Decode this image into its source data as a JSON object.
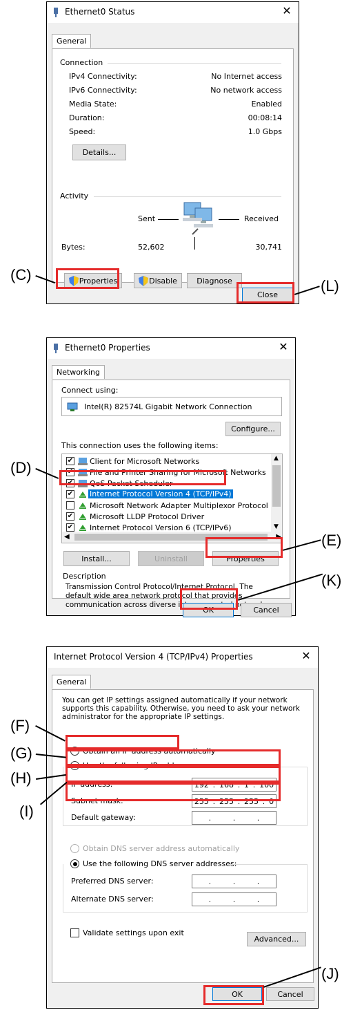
{
  "callouts": {
    "c": "(C)",
    "d": "(D)",
    "e": "(E)",
    "f": "(F)",
    "g": "(G)",
    "h": "(H)",
    "i": "(I)",
    "j": "(J)",
    "k": "(K)",
    "l": "(L)"
  },
  "status_dialog": {
    "title": "Ethernet0 Status",
    "tab": "General",
    "connection_header": "Connection",
    "rows": [
      {
        "label": "IPv4 Connectivity:",
        "value": "No Internet access"
      },
      {
        "label": "IPv6 Connectivity:",
        "value": "No network access"
      },
      {
        "label": "Media State:",
        "value": "Enabled"
      },
      {
        "label": "Duration:",
        "value": "00:08:14"
      },
      {
        "label": "Speed:",
        "value": "1.0 Gbps"
      }
    ],
    "details_button": "Details...",
    "activity_header": "Activity",
    "sent_label": "Sent",
    "received_label": "Received",
    "bytes_label": "Bytes:",
    "bytes_sent": "52,602",
    "bytes_received": "30,741",
    "properties_button": "Properties",
    "disable_button": "Disable",
    "diagnose_button": "Diagnose",
    "close_button": "Close",
    "close_glyph": "✕"
  },
  "properties_dialog": {
    "title": "Ethernet0 Properties",
    "tab": "Networking",
    "connect_using_label": "Connect using:",
    "adapter_name": "Intel(R) 82574L Gigabit Network Connection",
    "configure_button": "Configure...",
    "items_label": "This connection uses the following items:",
    "items": [
      {
        "label": "Client for Microsoft Networks",
        "checked": true,
        "icon": "client-icon"
      },
      {
        "label": "File and Printer Sharing for Microsoft Networks",
        "checked": true,
        "icon": "sharing-icon"
      },
      {
        "label": "QoS Packet Scheduler",
        "checked": true,
        "icon": "qos-icon"
      },
      {
        "label": "Internet Protocol Version 4 (TCP/IPv4)",
        "checked": true,
        "icon": "protocol-icon",
        "selected": true
      },
      {
        "label": "Microsoft Network Adapter Multiplexor Protocol",
        "checked": false,
        "icon": "protocol-icon"
      },
      {
        "label": "Microsoft LLDP Protocol Driver",
        "checked": true,
        "icon": "protocol-icon"
      },
      {
        "label": "Internet Protocol Version 6 (TCP/IPv6)",
        "checked": true,
        "icon": "protocol-icon"
      }
    ],
    "install_button": "Install...",
    "uninstall_button": "Uninstall",
    "properties_button": "Properties",
    "description_header": "Description",
    "description_text": "Transmission Control Protocol/Internet Protocol. The default wide area network protocol that provides communication across diverse interconnected networks.",
    "ok_button": "OK",
    "cancel_button": "Cancel",
    "close_glyph": "✕"
  },
  "ipv4_dialog": {
    "title": "Internet Protocol Version 4 (TCP/IPv4) Properties",
    "tab": "General",
    "intro_text": "You can get IP settings assigned automatically if your network supports this capability. Otherwise, you need to ask your network administrator for the appropriate IP settings.",
    "obtain_ip_auto": "Obtain an IP address automatically",
    "use_following_ip": "Use the following IP address:",
    "ip_address_label": "IP address:",
    "ip_address": [
      "192",
      "168",
      "1",
      "100"
    ],
    "subnet_label": "Subnet mask:",
    "subnet_mask": [
      "255",
      "255",
      "255",
      "0"
    ],
    "gateway_label": "Default gateway:",
    "gateway": [
      "",
      "",
      "",
      ""
    ],
    "obtain_dns_auto": "Obtain DNS server address automatically",
    "use_following_dns": "Use the following DNS server addresses:",
    "preferred_dns_label": "Preferred DNS server:",
    "alternate_dns_label": "Alternate DNS server:",
    "validate_label": "Validate settings upon exit",
    "advanced_button": "Advanced...",
    "ok_button": "OK",
    "cancel_button": "Cancel",
    "close_glyph": "✕"
  }
}
